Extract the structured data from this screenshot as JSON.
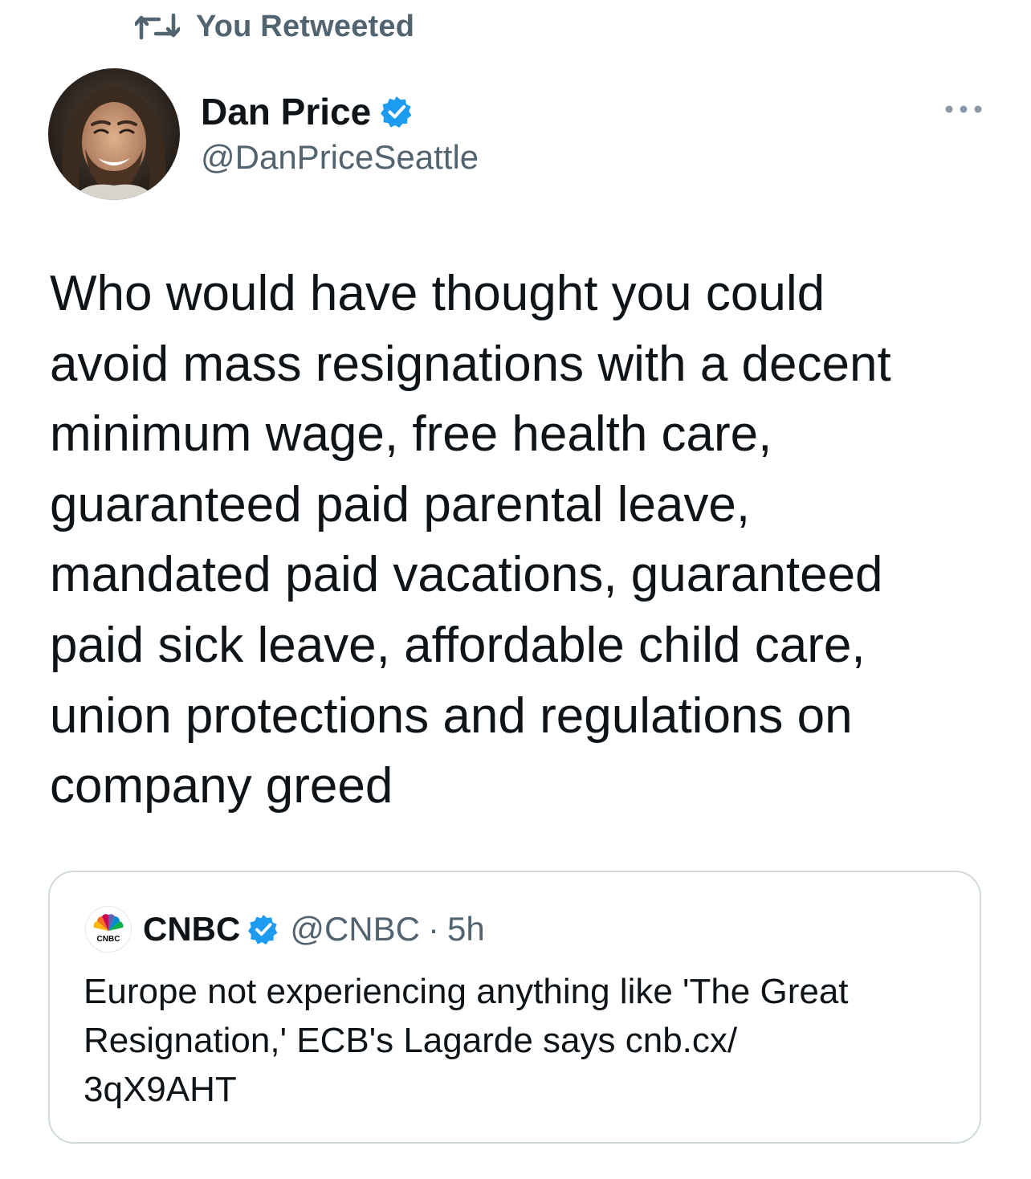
{
  "colors": {
    "text_primary": "#0f1419",
    "text_secondary": "#536471",
    "verified_blue": "#1d9bf0",
    "border": "#cfd9de"
  },
  "social_context": {
    "icon": "retweet-icon",
    "label": "You Retweeted"
  },
  "tweet": {
    "author": {
      "display_name": "Dan Price",
      "handle": "@DanPriceSeattle",
      "verified": true,
      "avatar": "avatar-photo"
    },
    "more_icon": "more-options-icon",
    "text": "Who would have thought you could\navoid mass resignations with a decent\nminimum wage, free health care,\nguaranteed paid parental leave,\nmandated paid vacations, guaranteed\npaid sick leave, affordable child care,\nunion protections and regulations on\ncompany greed"
  },
  "quoted_tweet": {
    "author": {
      "display_name": "CNBC",
      "handle": "@CNBC",
      "verified": true,
      "avatar": "cnbc-logo"
    },
    "separator": "·",
    "time": "5h",
    "text": "Europe not experiencing anything like 'The Great\nResignation,' ECB's Lagarde says cnb.cx/\n3qX9AHT"
  }
}
